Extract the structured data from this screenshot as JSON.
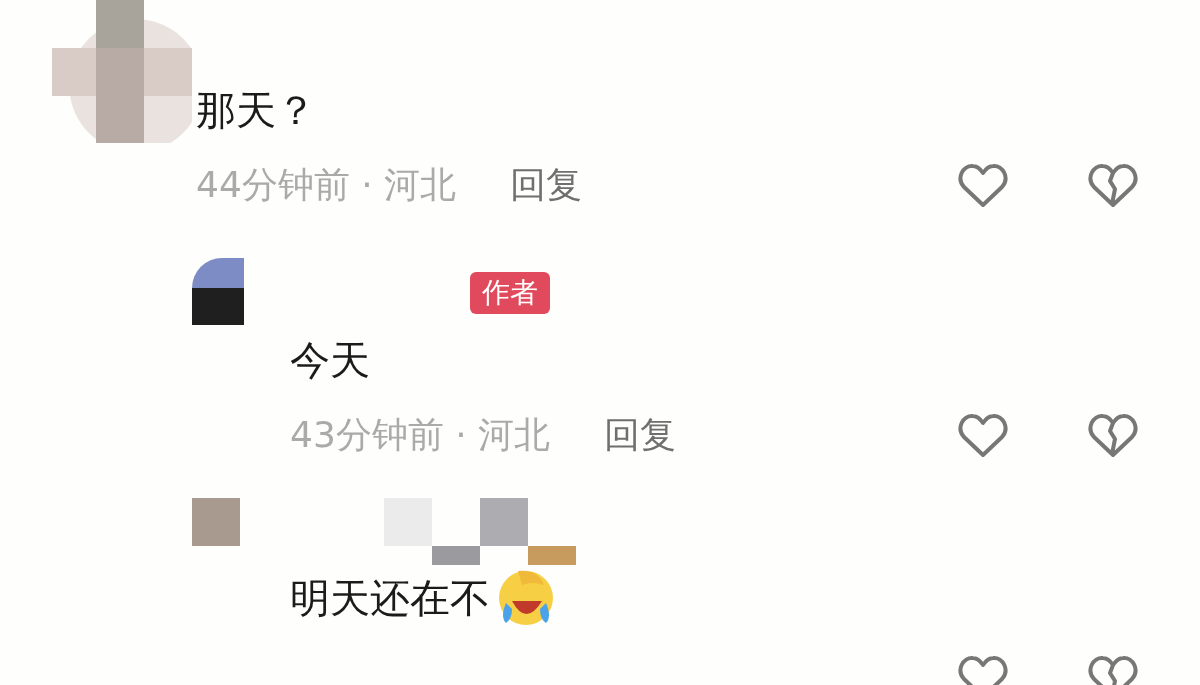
{
  "comments": [
    {
      "text": "那天？",
      "time": "44分钟前 · 河北",
      "reply": "回复",
      "children": [
        {
          "badge": "作者",
          "text": "今天",
          "time": "43分钟前 · 河北",
          "reply": "回复",
          "kind": "round"
        },
        {
          "text": "明天还在不",
          "emoji": true,
          "kind": "square"
        }
      ]
    }
  ]
}
